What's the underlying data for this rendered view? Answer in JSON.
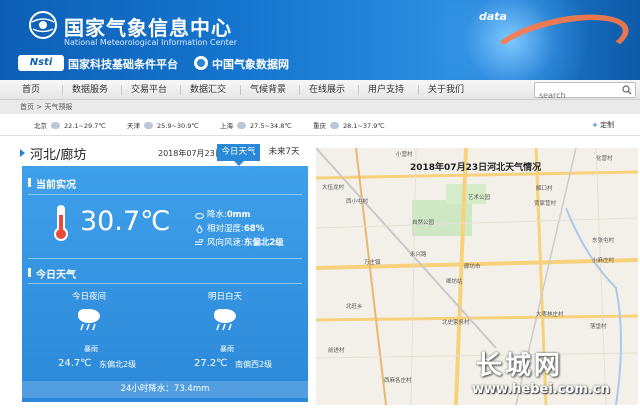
{
  "header": {
    "title_cn": "国家气象信息中心",
    "title_en": "National Meteorological Information Center",
    "data_text": "data",
    "partner1_logo": "Nsti",
    "partner1": "国家科技基础条件平台",
    "partner2": "中国气象数据网"
  },
  "nav": {
    "items": [
      "首页",
      "数据服务",
      "交易平台",
      "数据汇交",
      "气候背景",
      "在线展示",
      "用户支持",
      "关于我们"
    ],
    "search_placeholder": "search"
  },
  "breadcrumb": "首页 > 天气预报",
  "cities": [
    {
      "name": "北京",
      "temp": "22.1~29.7℃"
    },
    {
      "name": "天津",
      "temp": "25.9~30.9℃"
    },
    {
      "name": "上海",
      "temp": "27.5~34.8℃"
    },
    {
      "name": "重庆",
      "temp": "28.1~37.9℃"
    }
  ],
  "customize": "定制",
  "location": "河北/廊坊",
  "date": "2018年07月23日",
  "tabs": {
    "today": "今日天气",
    "week": "未来7天"
  },
  "current": {
    "title": "当前实况",
    "temp": "30.7℃",
    "precip_label": "降水:",
    "precip_value": "0mm",
    "humidity_label": "相对湿度:",
    "humidity_value": "68%",
    "wind_label": "风向风速:",
    "wind_value": "东偏北2级"
  },
  "today": {
    "title": "今日天气",
    "night": {
      "label": "今日夜间",
      "weather": "暴雨",
      "temp": "24.7℃",
      "wind": "东偏北2级"
    },
    "day": {
      "label": "明日白天",
      "weather": "暴雨",
      "temp": "27.2℃",
      "wind": "南偏西2级"
    },
    "rain_total": "24小时降水：73.4mm"
  },
  "map": {
    "title": "2018年07月23日河北天气情况",
    "labels": [
      "小营村",
      "化营村",
      "大伍龙村",
      "解口村",
      "西小屯村",
      "贾家营村",
      "艺术公园",
      "自然公园",
      "廊坊市",
      "卿坊站",
      "永兴路",
      "万庄镇",
      "东张屯村",
      "小麻庄村",
      "北史家务村",
      "大枣林庄村",
      "落垡村",
      "北旺乡",
      "前进村",
      "西麻各庄村",
      "麻庄村"
    ],
    "watermark": "长城网",
    "watermark_url": "www.hebei.com.cn"
  },
  "colors": {
    "header": "#1677d0",
    "panel": "#2b88d8",
    "accent": "#2a7fcf"
  }
}
